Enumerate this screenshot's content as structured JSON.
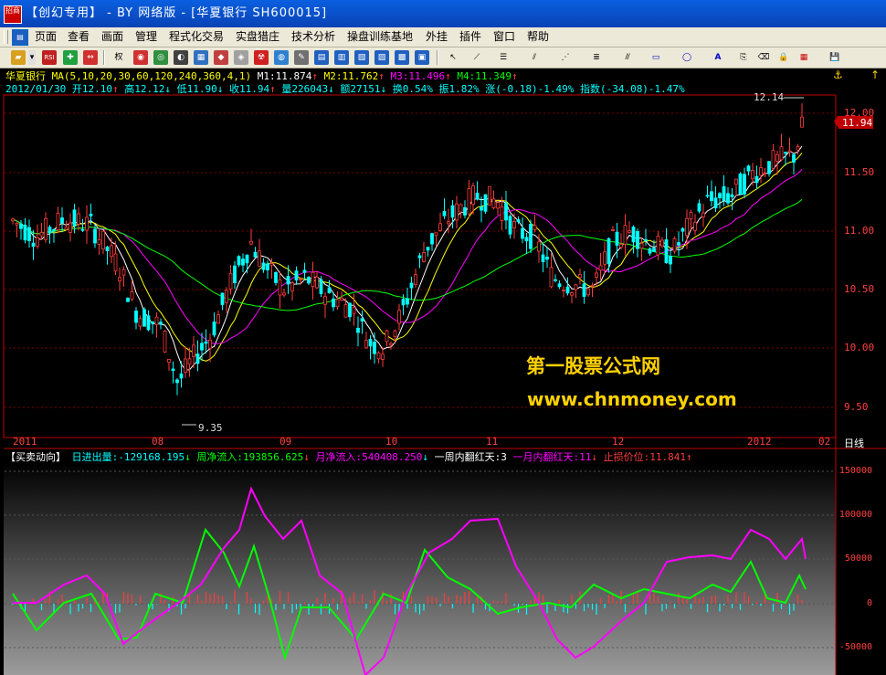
{
  "window": {
    "title": "【创幻专用】 - BY 网络版 - [华夏银行 SH600015]",
    "logo": "招商"
  },
  "menu": [
    "页面",
    "查看",
    "画面",
    "管理",
    "程式化交易",
    "实盘猎庄",
    "技术分析",
    "操盘训练基地",
    "外挂",
    "插件",
    "窗口",
    "帮助"
  ],
  "toolbar": {
    "items": [
      "RSI",
      "权"
    ]
  },
  "stock": {
    "name": "华夏银行",
    "ma_params": "MA(5,10,20,30,60,120,240,360,4,1)",
    "m1": "M1:11.874",
    "m2": "M2:11.762",
    "m3": "M3:11.496",
    "m4": "M4:11.349",
    "date": "2012/01/30",
    "open": "开12.10",
    "high": "高12.12",
    "low": "低11.90",
    "close": "收11.94",
    "volume": "量226043",
    "amount": "额27151",
    "turnover": "换0.54%",
    "amplitude": "振1.82%",
    "change": "涨(-0.18)-1.49%",
    "index": "指数(-34.08)-1.47%"
  },
  "price_axis": [
    "12.00",
    "11.50",
    "11.00",
    "10.50",
    "10.00",
    "9.50"
  ],
  "current_price": "11.94",
  "annotations": {
    "high": "12.14",
    "low": "9.35"
  },
  "x_axis": [
    "2011",
    "08",
    "09",
    "10",
    "11",
    "12",
    "2012",
    "02"
  ],
  "period_label": "日线",
  "watermark": {
    "line1": "第一股票公式网",
    "line2": "www.chnmoney.com"
  },
  "indicator": {
    "name": "【买卖动向】",
    "daily": "日进出量:-129168.195",
    "weekly": "周净流入:193856.625",
    "monthly": "月净流入:540408.250",
    "week_red": "一周内翻红天:3",
    "month_red": "一月内翻红天:11",
    "stop_loss": "止损价位:11.841",
    "axis": [
      "150000",
      "100000",
      "50000",
      "0",
      "-50000"
    ]
  },
  "colors": {
    "up": "#ff3b3b",
    "down": "#00ffff",
    "ma1": "#ffffff",
    "ma2": "#ffff00",
    "ma3": "#ff00ff",
    "ma4": "#00ff00"
  }
}
